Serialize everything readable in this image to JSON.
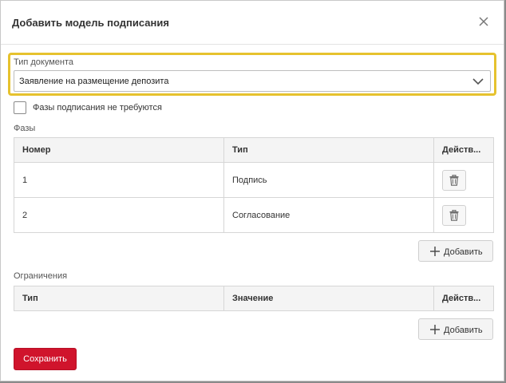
{
  "dialog": {
    "title": "Добавить модель подписания",
    "close_icon": "close-icon"
  },
  "document_type": {
    "label": "Тип документа",
    "selected": "Заявление на размещение депозита",
    "highlight_color": "#e6c22e"
  },
  "no_phases_checkbox": {
    "label": "Фазы подписания не требуются",
    "checked": false
  },
  "phases": {
    "label": "Фазы",
    "columns": [
      "Номер",
      "Тип",
      "Действ..."
    ],
    "rows": [
      {
        "number": "1",
        "type": "Подпись",
        "action_icon": "trash-icon"
      },
      {
        "number": "2",
        "type": "Согласование",
        "action_icon": "trash-icon"
      }
    ],
    "add_label": "Добавить"
  },
  "restrictions": {
    "label": "Ограничения",
    "columns": [
      "Тип",
      "Значение",
      "Действ..."
    ],
    "add_label": "Добавить"
  },
  "save_label": "Сохранить",
  "colors": {
    "primary": "#d0142c",
    "header_bg": "#f4f4f4",
    "border": "#d6d6d6"
  }
}
